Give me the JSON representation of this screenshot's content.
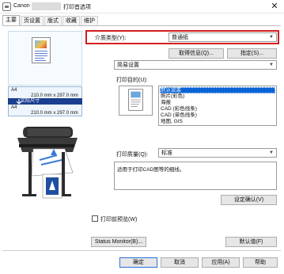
{
  "window": {
    "app_name": "Canon",
    "title_suffix": "打印首选项",
    "close_glyph": "✕"
  },
  "tabs": [
    {
      "label": "主要"
    },
    {
      "label": "页设置"
    },
    {
      "label": "版式"
    },
    {
      "label": "收藏"
    },
    {
      "label": "维护"
    }
  ],
  "preview": {
    "paper_size": "A4",
    "paper_dims": "210.0 mm x 297.0 mm",
    "scale_label": "实际尺寸",
    "output_size": "A4",
    "output_dims": "210.0 mm x 297.0 mm"
  },
  "media": {
    "label": "介质类型(Y):",
    "value": "普通纸"
  },
  "buttons": {
    "get_info": "取得信息(Q)...",
    "specify": "指定(S)...",
    "settings_confirm": "设定确认(V)",
    "status_monitor": "Status Monitor(B)...",
    "defaults": "默认值(F)",
    "ok": "确定",
    "cancel": "取消",
    "apply": "应用(A)",
    "help": "帮助"
  },
  "mode_select": {
    "value": "简易设置"
  },
  "purpose": {
    "label": "打印目的(U):",
    "items": [
      "默认设置",
      "照片(彩色)",
      "海报",
      "CAD (彩色线条)",
      "CAD (单色线条)",
      "地图, GIS"
    ],
    "selected_index": 0
  },
  "quality": {
    "label": "打印质量(Q):",
    "value": "标准"
  },
  "description": "适用于打印CAD图等的细线。",
  "preview_option": {
    "label": "打印前预览(W)",
    "checked": false
  },
  "icons": {
    "close": "close-icon",
    "dropdown": "chevron-down-icon",
    "printer": "printer-icon",
    "app": "printer-app-icon"
  }
}
